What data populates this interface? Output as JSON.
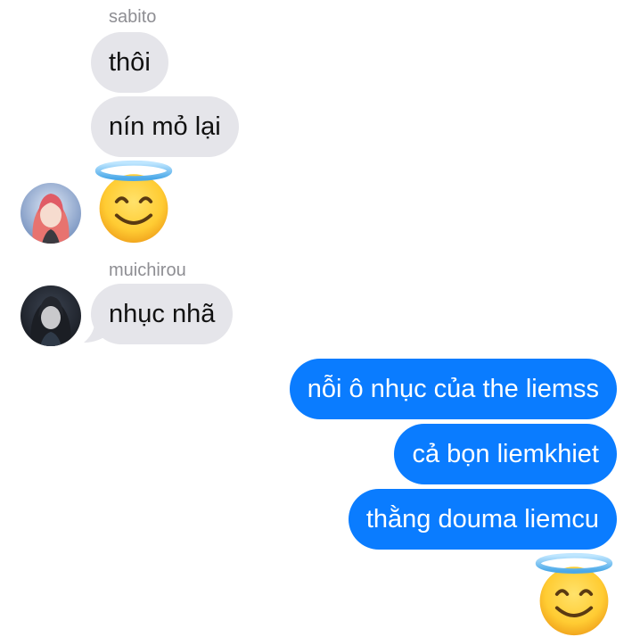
{
  "messages": {
    "sabito": {
      "sender": "sabito",
      "texts": [
        "thôi",
        "nín mỏ lại"
      ],
      "reaction_icon": "smiling-face-with-halo-icon",
      "avatar_icon": "pink-haired-character-avatar"
    },
    "muichirou": {
      "sender": "muichirou",
      "texts": [
        "nhục nhã"
      ],
      "avatar_icon": "dark-haired-character-avatar"
    },
    "me": {
      "texts": [
        "nỗi ô nhục của the liemss",
        "cả bọn liemkhiet",
        "thằng douma liemcu"
      ],
      "reaction_icon": "smiling-face-with-halo-icon"
    }
  },
  "colors": {
    "incoming_bubble": "#e5e5ea",
    "outgoing_bubble": "#0a7cff",
    "sender_name": "#8e8e93"
  }
}
